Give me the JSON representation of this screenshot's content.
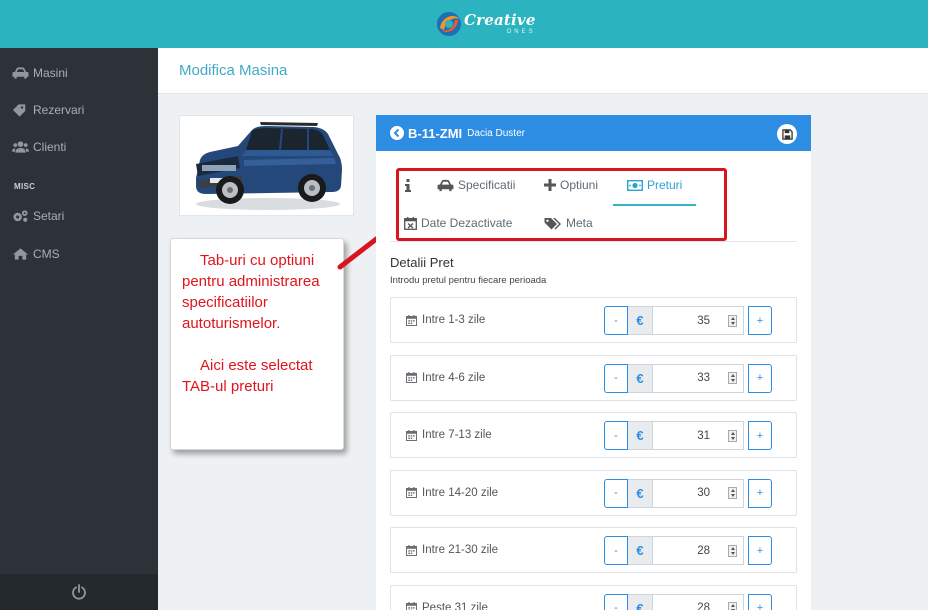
{
  "brand": {
    "name": "Creative",
    "tagline": "ONES"
  },
  "sidebar": {
    "items": [
      {
        "label": "Masini",
        "icon": "car-icon"
      },
      {
        "label": "Rezervari",
        "icon": "tag-icon"
      },
      {
        "label": "Clienti",
        "icon": "users-icon"
      }
    ],
    "section_label": "MISC",
    "misc_items": [
      {
        "label": "Setari",
        "icon": "gears-icon"
      },
      {
        "label": "CMS",
        "icon": "home-icon"
      }
    ],
    "footer_icon": "power-icon"
  },
  "page": {
    "title": "Modifica Masina"
  },
  "annotation": {
    "paragraph_1": "Tab-uri cu optiuni pentru administrarea specificatiilor autoturismelor.",
    "paragraph_2": "Aici este selectat TAB-ul preturi",
    "color": "#e0141c"
  },
  "vehicle": {
    "plate": "B-11-ZMI",
    "model": "Dacia Duster"
  },
  "tabs": [
    {
      "label": "",
      "icon": "info-icon"
    },
    {
      "label": "Specificatii",
      "icon": "car-icon"
    },
    {
      "label": "Optiuni",
      "icon": "plus-icon"
    },
    {
      "label": "Preturi",
      "icon": "money-icon",
      "active": true
    },
    {
      "label": "Date Dezactivate",
      "icon": "calendar-x-icon"
    },
    {
      "label": "Meta",
      "icon": "tags-icon"
    }
  ],
  "pricing": {
    "title": "Detalii Pret",
    "subtitle": "Introdu pretul pentru fiecare perioada",
    "minus_label": "-",
    "plus_label": "+",
    "currency": "€",
    "rows": [
      {
        "label": "Intre 1-3 zile",
        "value": "35"
      },
      {
        "label": "Intre 4-6 zile",
        "value": "33"
      },
      {
        "label": "Intre 7-13 zile",
        "value": "31"
      },
      {
        "label": "Intre 14-20 zile",
        "value": "30"
      },
      {
        "label": "Intre 21-30 zile",
        "value": "28"
      },
      {
        "label": "Peste 31 zile",
        "value": "28"
      }
    ]
  },
  "colors": {
    "topbar": "#2bb3c0",
    "sidebar": "#2c3237",
    "card_header": "#2d8de3",
    "accent": "#2ba3cf",
    "annotation_red": "#d8141e"
  }
}
